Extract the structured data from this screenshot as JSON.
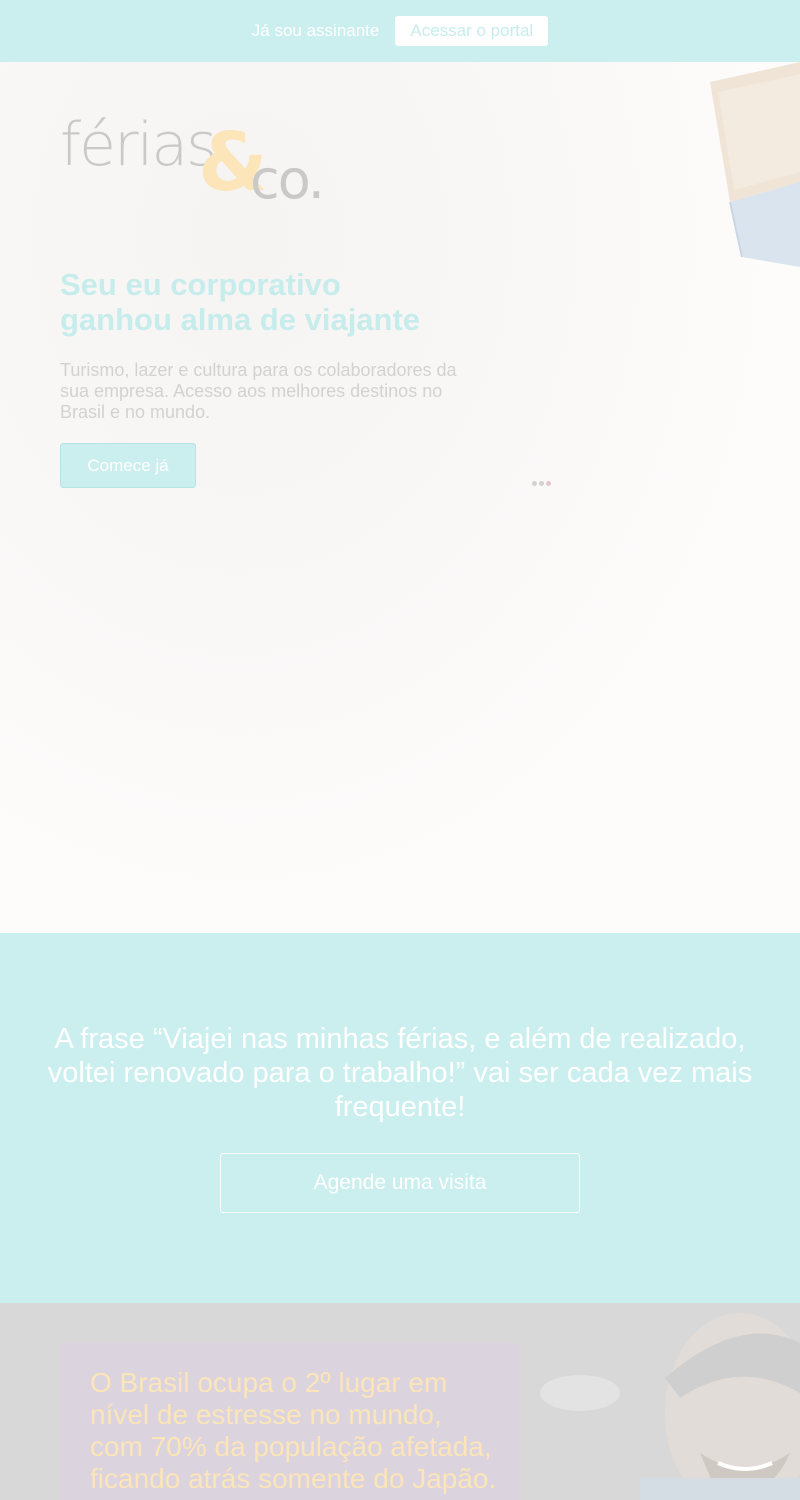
{
  "topbar": {
    "subscriber_text": "Já sou assinante",
    "portal_button": "Acessar o portal"
  },
  "hero": {
    "logo": {
      "word": "férias",
      "amp": "&",
      "co": "co."
    },
    "headline_line1": "Seu eu corporativo",
    "headline_line2": "ganhou alma de viajante",
    "subtext": "Turismo, lazer e cultura para os colaboradores da sua empresa. Acesso aos melhores destinos no Brasil e no mundo.",
    "cta_button": "Comece já",
    "slider": {
      "total": 3,
      "active_index": 2
    }
  },
  "quote": {
    "text": "A frase “Viajei nas minhas férias, e além de realizado, voltei renovado para o trabalho!” vai ser cada vez mais frequente!",
    "button": "Agende uma visita"
  },
  "stress": {
    "text": "O Brasil ocupa o 2º lugar em nível de estresse no mundo, com 70% da população afetada, ficando atrás somente do Japão."
  },
  "colors": {
    "accent_teal": "#cbeeee",
    "logo_gold": "#fbe5b9",
    "logo_gray": "#c9c9c9",
    "stress_box": "#dbd3de"
  }
}
